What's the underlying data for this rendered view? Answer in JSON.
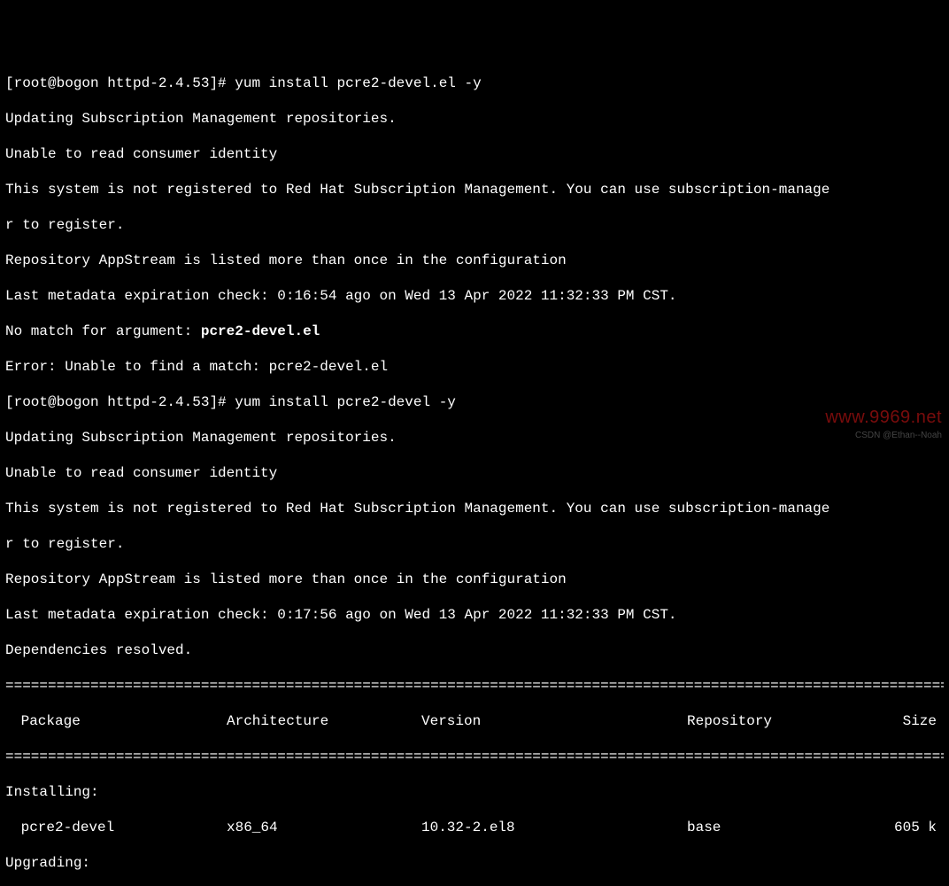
{
  "term": {
    "prompt1": "[root@bogon httpd-2.4.53]# ",
    "cmd1": "yum install pcre2-devel.el -y",
    "line_updating": "Updating Subscription Management repositories.",
    "line_unable": "Unable to read consumer identity",
    "line_notreg": "This system is not registered to Red Hat Subscription Management. You can use subscription-manage",
    "line_notreg2": "r to register.",
    "line_repo": "Repository AppStream is listed more than once in the configuration",
    "line_meta1": "Last metadata expiration check: 0:16:54 ago on Wed 13 Apr 2022 11:32:33 PM CST.",
    "line_nomatch_pre": "No match for argument: ",
    "line_nomatch_arg": "pcre2-devel.el",
    "line_error": "Error: Unable to find a match: pcre2-devel.el",
    "prompt2": "[root@bogon httpd-2.4.53]# ",
    "cmd2": "yum install pcre2-devel -y",
    "line_meta2": "Last metadata expiration check: 0:17:56 ago on Wed 13 Apr 2022 11:32:33 PM CST.",
    "line_dep": "Dependencies resolved.",
    "hr": "===============================================================================================================================",
    "header": {
      "pkg": " Package",
      "arch": "Architecture",
      "ver": "Version",
      "repo": "Repository",
      "size": "Size"
    },
    "section_installing": "Installing:",
    "row1": {
      "pkg": " pcre2-devel",
      "arch": "x86_64",
      "ver": "10.32-2.el8",
      "repo": "base",
      "size": "605 k"
    },
    "section_upgrading": "Upgrading:"
  },
  "watermark": {
    "red": "www.9969.net",
    "gray": "CSDN @Ethan--Noah"
  }
}
